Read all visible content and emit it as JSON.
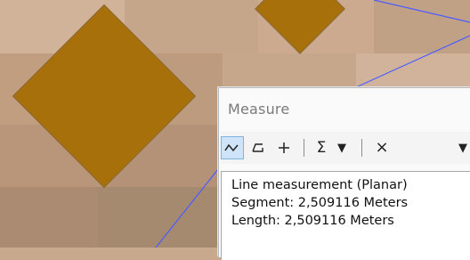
{
  "map": {
    "feature_fill": "#a8700a",
    "line_color": "#4a5cff"
  },
  "measure_window": {
    "title": "Measure",
    "toolbar": {
      "measure_line_icon": "polyline-measure-icon",
      "measure_area_icon": "area-measure-icon",
      "measure_feature_icon": "crosshair-plus-icon",
      "sum_label": "Σ",
      "dropdown_label": "▼",
      "clear_label": "×",
      "units_dropdown_label": "▼"
    },
    "results": {
      "line1": "Line measurement (Planar)",
      "line2": "Segment: 2,509116 Meters",
      "line3": "Length: 2,509116 Meters"
    }
  }
}
